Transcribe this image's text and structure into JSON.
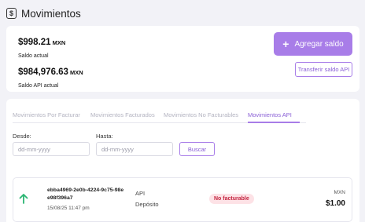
{
  "header": {
    "icon": "dollar-document-icon",
    "icon_glyph": "$",
    "title": "Movimientos"
  },
  "balances": {
    "current": {
      "amount": "$998.21",
      "currency": "MXN",
      "label": "Saldo actual"
    },
    "api": {
      "amount": "$984,976.63",
      "currency": "MXN",
      "label": "Saldo API actual"
    },
    "add_button": {
      "icon": "plus-icon",
      "glyph": "+",
      "label": "Agregar saldo"
    },
    "transfer_button": {
      "label": "Transferir saldo API"
    }
  },
  "tabs": [
    {
      "label": "Movimientos Por Facturar",
      "active": false
    },
    {
      "label": "Movimientos Facturados",
      "active": false
    },
    {
      "label": "Movimientos No Facturables",
      "active": false
    },
    {
      "label": "Movimientos API",
      "active": true
    }
  ],
  "filters": {
    "from_label": "Desde:",
    "from_placeholder": "dd-mm-yyyy",
    "to_label": "Hasta:",
    "to_placeholder": "dd-mm-yyyy",
    "search_label": "Buscar"
  },
  "movements": [
    {
      "direction_icon": "arrow-up-icon",
      "id": "ebba4969-2e0b-4224-9c75-98ee98f396a7",
      "date": "15/08/25 11:47 pm",
      "source": "API",
      "type": "Depósito",
      "status": "No facturable",
      "currency": "MXN",
      "amount": "$1.00"
    }
  ],
  "colors": {
    "accent": "#a87de8",
    "accent_text": "#8a5fd6",
    "badge_bg": "#fde2e6",
    "badge_text": "#c4243f",
    "arrow_up": "#2bb673",
    "page_bg": "#f2f2f7"
  }
}
